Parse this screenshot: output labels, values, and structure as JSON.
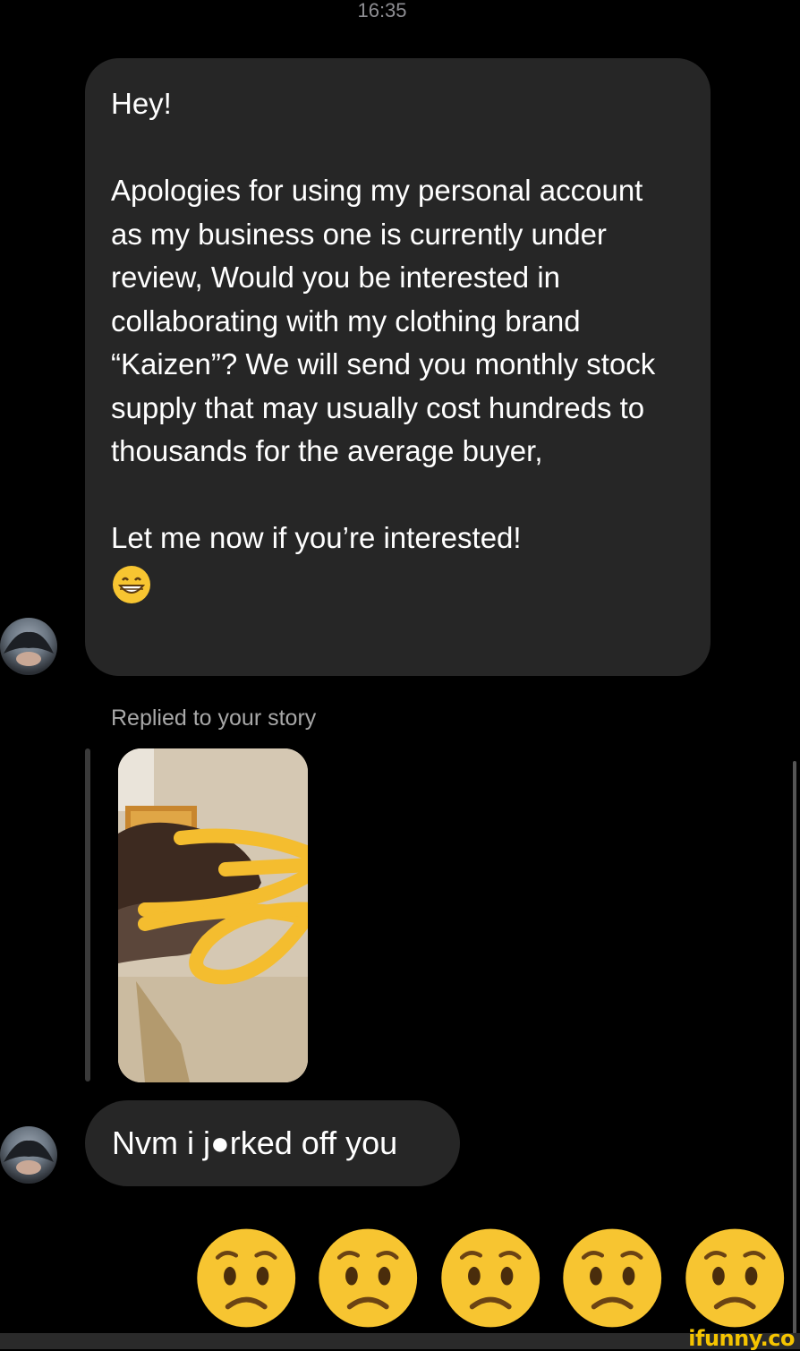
{
  "status_time": "16:35",
  "messages": {
    "first": {
      "text": "Hey!\n\nApologies for using my personal account as my business one is currently under review, Would you be interested in collaborating with my clothing brand “Kaizen”? We will send you monthly stock supply that may usually cost hundreds to thousands for the average buyer,\n\nLet me now if you’re interested!",
      "emoji": "grinning-face"
    },
    "story_reply_label": "Replied to your story",
    "reply_text": "Nvm i j●rked off you"
  },
  "reactions": [
    "worried-face",
    "worried-face",
    "worried-face",
    "worried-face",
    "worried-face"
  ],
  "watermark": "ifunny.co",
  "colors": {
    "background": "#000000",
    "bubble": "#262626",
    "muted_text": "#a8a8a8",
    "emoji_yellow": "#f7c531",
    "scribble": "#f4bd2f",
    "watermark": "#f5c400"
  }
}
